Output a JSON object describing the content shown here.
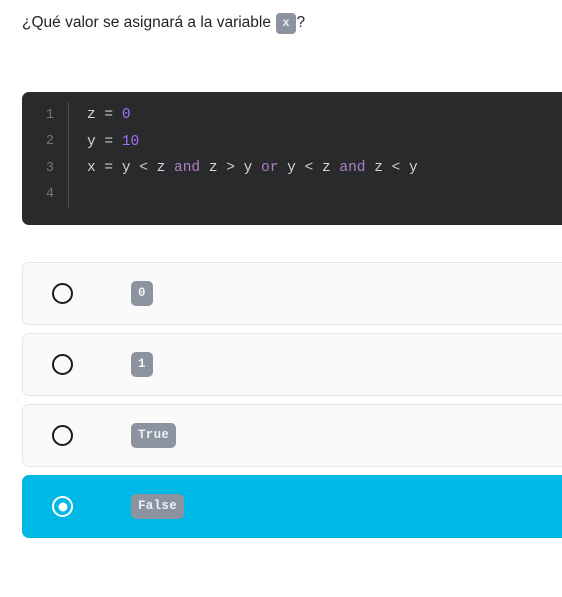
{
  "question": {
    "prefix": "¿Qué valor se asignará a la variable ",
    "variable": "x",
    "suffix": "?"
  },
  "code": {
    "language": "python",
    "lines": [
      {
        "number": "1",
        "text": "z = 0",
        "tokens": [
          {
            "t": "z",
            "k": "var"
          },
          {
            "t": " = ",
            "k": "op"
          },
          {
            "t": "0",
            "k": "num"
          }
        ]
      },
      {
        "number": "2",
        "text": "y = 10",
        "tokens": [
          {
            "t": "y",
            "k": "var"
          },
          {
            "t": " = ",
            "k": "op"
          },
          {
            "t": "10",
            "k": "num"
          }
        ]
      },
      {
        "number": "3",
        "text": "x = y < z and z > y or y < z and z < y",
        "tokens": [
          {
            "t": "x",
            "k": "var"
          },
          {
            "t": " = ",
            "k": "op"
          },
          {
            "t": "y",
            "k": "var"
          },
          {
            "t": " < ",
            "k": "op"
          },
          {
            "t": "z",
            "k": "var"
          },
          {
            "t": " ",
            "k": "op"
          },
          {
            "t": "and",
            "k": "kw"
          },
          {
            "t": " ",
            "k": "op"
          },
          {
            "t": "z",
            "k": "var"
          },
          {
            "t": " > ",
            "k": "op"
          },
          {
            "t": "y",
            "k": "var"
          },
          {
            "t": " ",
            "k": "op"
          },
          {
            "t": "or",
            "k": "kw"
          },
          {
            "t": " ",
            "k": "op"
          },
          {
            "t": "y",
            "k": "var"
          },
          {
            "t": " < ",
            "k": "op"
          },
          {
            "t": "z",
            "k": "var"
          },
          {
            "t": " ",
            "k": "op"
          },
          {
            "t": "and",
            "k": "kw"
          },
          {
            "t": " ",
            "k": "op"
          },
          {
            "t": "z",
            "k": "var"
          },
          {
            "t": " < ",
            "k": "op"
          },
          {
            "t": "y",
            "k": "var"
          }
        ]
      },
      {
        "number": "4",
        "text": "",
        "tokens": []
      }
    ]
  },
  "options": [
    {
      "label": "0",
      "selected": false
    },
    {
      "label": "1",
      "selected": false
    },
    {
      "label": "True",
      "selected": false
    },
    {
      "label": "False",
      "selected": true
    }
  ],
  "colors": {
    "accent_selected": "#00b8e6",
    "code_background": "#282a2c",
    "code_number": "#a371f7",
    "code_keyword": "#b07ec9",
    "code_text": "#d6d7da",
    "code_line_number": "#6f7479",
    "badge_background": "#8b93a1",
    "badge_text": "#eef1f5",
    "card_background": "#fafafa",
    "card_border": "#e4e6eb"
  }
}
